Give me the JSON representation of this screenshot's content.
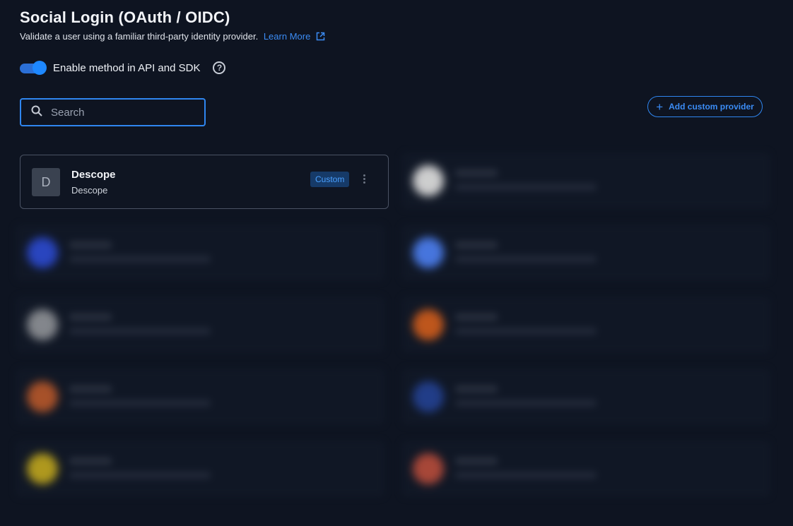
{
  "header": {
    "title": "Social Login (OAuth / OIDC)",
    "subtitle": "Validate a user using a familiar third-party identity provider.",
    "learn_more": "Learn More"
  },
  "toggle": {
    "label": "Enable method in API and SDK",
    "enabled": true,
    "help": "?"
  },
  "search": {
    "placeholder": "Search",
    "value": ""
  },
  "add_custom_provider": {
    "label": "Add custom provider",
    "icon": "plus-icon"
  },
  "providers": [
    {
      "initial": "D",
      "name": "Descope",
      "description": "Descope",
      "badge": "Custom",
      "menu_icon": "kebab-icon"
    }
  ],
  "colors": {
    "background": "#0e1421",
    "accent": "#2f86f0",
    "badge_bg": "#163a68",
    "badge_text": "#4aa0ff"
  }
}
